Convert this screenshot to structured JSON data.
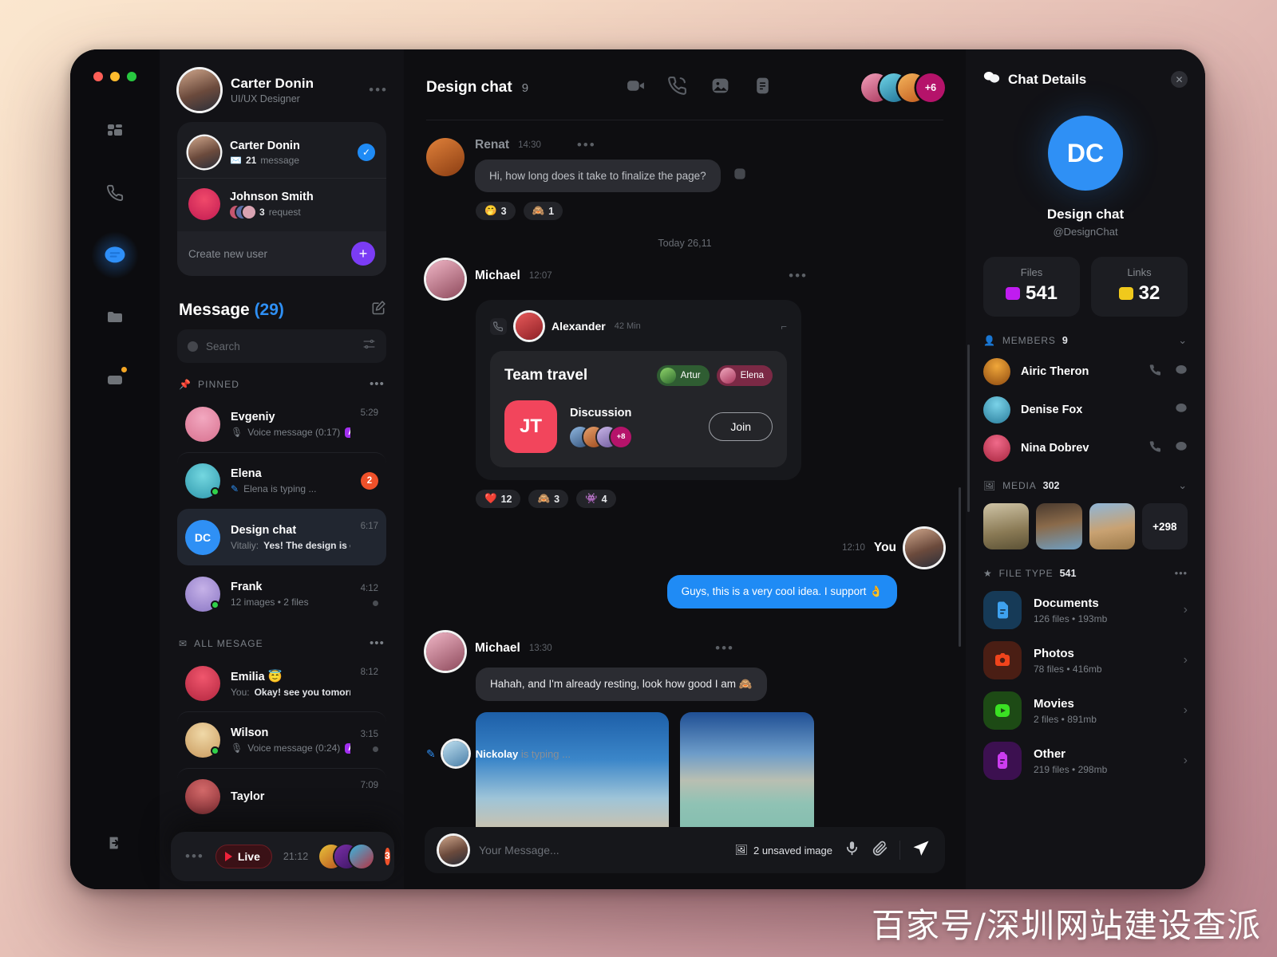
{
  "rail": {
    "items": [
      {
        "name": "dashboard",
        "icon": "grid-icon",
        "active": false
      },
      {
        "name": "calls",
        "icon": "phone-icon",
        "active": false
      },
      {
        "name": "messages",
        "icon": "chat-icon",
        "active": true
      },
      {
        "name": "files",
        "icon": "folder-icon",
        "active": false
      },
      {
        "name": "archive",
        "icon": "archive-icon",
        "active": false,
        "badge": true
      }
    ],
    "logout_icon": "logout-icon"
  },
  "profile": {
    "name": "Carter Donin",
    "role": "UI/UX Designer",
    "menu": "•••"
  },
  "user_card": {
    "rows": [
      {
        "name": "Carter Donin",
        "count": "21",
        "meta": "message",
        "icon": "envelope-icon",
        "verified": true
      },
      {
        "name": "Johnson Smith",
        "count": "3",
        "meta": "request",
        "icon": "avatar-stack",
        "verified": false
      }
    ],
    "create_label": "Create new user",
    "create_icon": "plus-icon"
  },
  "message_panel": {
    "title": "Message",
    "count": "(29)",
    "compose_icon": "compose-icon",
    "search": {
      "placeholder": "Search",
      "filter_icon": "filter-icon"
    },
    "sections": [
      {
        "label": "PINNED",
        "icon": "pin-icon",
        "menu": "•••",
        "chats": [
          {
            "name": "Evgeniy",
            "preview": "Voice message (0:17)",
            "preview_icon": "mic-icon",
            "time": "5:29",
            "tag": "Aa",
            "selected": false,
            "online": false,
            "badge": "",
            "dot": false
          },
          {
            "name": "Elena",
            "preview": "Elena is typing ...",
            "preview_icon": "pencil-icon",
            "time": "",
            "tag": "",
            "selected": false,
            "online": true,
            "badge": "2",
            "dot": false
          },
          {
            "name": "Design chat",
            "preview_prefix": "Vitaliy:",
            "preview": "Yes! The design is great",
            "time": "6:17",
            "tag": "",
            "selected": true,
            "online": false,
            "badge": "",
            "dot": false,
            "initials": "DC"
          },
          {
            "name": "Frank",
            "preview": "12 images  •  2 files",
            "time": "4:12",
            "tag": "",
            "selected": false,
            "online": true,
            "badge": "",
            "dot": true
          }
        ]
      },
      {
        "label": "ALL MESAGE",
        "icon": "envelope-icon",
        "menu": "•••",
        "chats": [
          {
            "name": "Emilia 😇",
            "preview_prefix": "You:",
            "preview": "Okay! see you tomorrow",
            "time": "8:12",
            "tag": "",
            "selected": false,
            "online": false,
            "badge": "",
            "dot": false
          },
          {
            "name": "Wilson",
            "preview": "Voice message (0:24)",
            "preview_icon": "mic-icon",
            "time": "3:15",
            "tag": "Aa",
            "selected": false,
            "online": true,
            "badge": "",
            "dot": true
          },
          {
            "name": "Taylor",
            "preview": "",
            "time": "7:09",
            "tag": "",
            "selected": false,
            "online": false,
            "badge": "",
            "dot": false
          }
        ]
      }
    ],
    "live_bar": {
      "menu": "•••",
      "label": "Live",
      "time": "21:12",
      "badge": "3",
      "play_icon": "play-icon"
    }
  },
  "chat": {
    "title": "Design chat",
    "member_count": "9",
    "header_icons": [
      "video-icon",
      "phone-icon",
      "image-icon",
      "document-icon"
    ],
    "participants_more": "+6",
    "day_separator": "Today 26,11",
    "messages": [
      {
        "author": "Renat",
        "time": "14:30",
        "menu": "•••",
        "text": "Hi, how long does it take to finalize the page?",
        "side": "left",
        "dim": true,
        "reactions": [
          {
            "emoji": "🤭",
            "count": "3"
          },
          {
            "emoji": "🙈",
            "count": "1"
          }
        ]
      },
      {
        "author": "Michael",
        "time": "12:07",
        "menu": "•••",
        "side": "left",
        "card": {
          "icon": "call-card-icon",
          "author": "Alexander",
          "time": "42 Min",
          "expand_icon": "expand-icon",
          "title": "Team travel",
          "tags": [
            {
              "label": "Artur",
              "color": "green"
            },
            {
              "label": "Elena",
              "color": "pink"
            }
          ],
          "initials": "JT",
          "subtitle": "Discussion",
          "extra_members": "+8",
          "join_label": "Join"
        },
        "reactions": [
          {
            "emoji": "❤️",
            "count": "12"
          },
          {
            "emoji": "🙈",
            "count": "3"
          },
          {
            "emoji": "👾",
            "count": "4"
          }
        ]
      },
      {
        "author": "You",
        "time": "12:10",
        "side": "right",
        "text": "Guys, this is a very cool idea. I support 👌"
      },
      {
        "author": "Michael",
        "time": "13:30",
        "menu": "•••",
        "side": "left",
        "text": "Hahah, and I'm already resting, look how good I am 🙈",
        "images": 2
      }
    ],
    "typing": {
      "name": "Nickolay",
      "text": "is typing ...",
      "icon": "pencil-icon"
    },
    "composer": {
      "placeholder": "Your Message...",
      "unsaved": "2 unsaved image",
      "unsaved_icon": "image-icon",
      "mic_icon": "mic-icon",
      "clip_icon": "paperclip-icon",
      "send_icon": "send-icon"
    }
  },
  "details": {
    "title": "Chat Details",
    "title_icon": "chat-bubbles-icon",
    "close_icon": "close-icon",
    "avatar_initials": "DC",
    "name": "Design chat",
    "handle": "@DesignChat",
    "stats": [
      {
        "label": "Files",
        "value": "541",
        "icon": "folder-icon",
        "color": "#c01cf0"
      },
      {
        "label": "Links",
        "value": "32",
        "icon": "link-icon",
        "color": "#f0c91c"
      }
    ],
    "members_section": {
      "label": "MEMBERS",
      "count": "9",
      "icon": "person-icon",
      "chevron": "chevron-down-icon"
    },
    "members": [
      {
        "name": "Airic Theron",
        "has_call": true,
        "has_chat": true
      },
      {
        "name": "Denise Fox",
        "has_call": false,
        "has_chat": true
      },
      {
        "name": "Nina Dobrev",
        "has_call": true,
        "has_chat": true
      }
    ],
    "media_section": {
      "label": "MEDIA",
      "count": "302",
      "icon": "image-icon",
      "chevron": "chevron-down-icon"
    },
    "media_more": "+298",
    "filetype_section": {
      "label": "FILE TYPE",
      "count": "541",
      "icon": "star-icon",
      "menu": "•••"
    },
    "file_types": [
      {
        "name": "Documents",
        "sub": "126 files  •  193mb",
        "icon": "document-icon",
        "bg": "#163a57",
        "fg": "#3ea2f0"
      },
      {
        "name": "Photos",
        "sub": "78 files  •  416mb",
        "icon": "camera-icon",
        "bg": "#4a1e14",
        "fg": "#f0441c"
      },
      {
        "name": "Movies",
        "sub": "2 files  •  891mb",
        "icon": "play-icon",
        "bg": "#1d4a15",
        "fg": "#3ae023"
      },
      {
        "name": "Other",
        "sub": "219 files  •  298mb",
        "icon": "clipboard-icon",
        "bg": "#3c1050",
        "fg": "#cc3cf0"
      }
    ]
  },
  "watermark": "百家号/深圳网站建设查派",
  "accent": "#1f8bf5"
}
